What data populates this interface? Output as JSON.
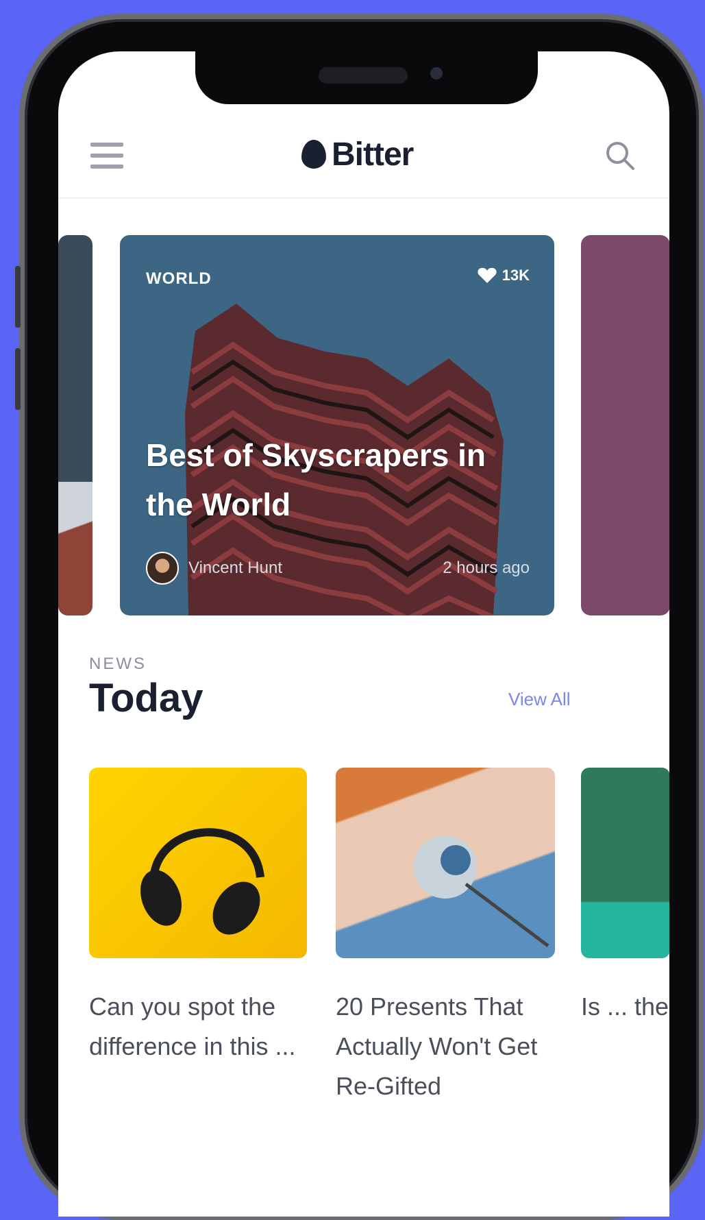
{
  "app": {
    "name": "Bitter"
  },
  "featured": {
    "category": "WORLD",
    "likes": "13K",
    "title": "Best of Skyscrapers in the World",
    "author": "Vincent Hunt",
    "time": "2 hours ago"
  },
  "section": {
    "eyebrow": "NEWS",
    "title": "Today",
    "view_all": "View All"
  },
  "articles": [
    {
      "title": "Can you spot the difference in this ..."
    },
    {
      "title": "20 Presents That Actually Won't Get Re-Gifted"
    },
    {
      "title": "Is ... the ... Bi..."
    }
  ],
  "colors": {
    "background": "#5a64f5",
    "accent": "#7c84f3",
    "featured_card": "#3d6684"
  }
}
